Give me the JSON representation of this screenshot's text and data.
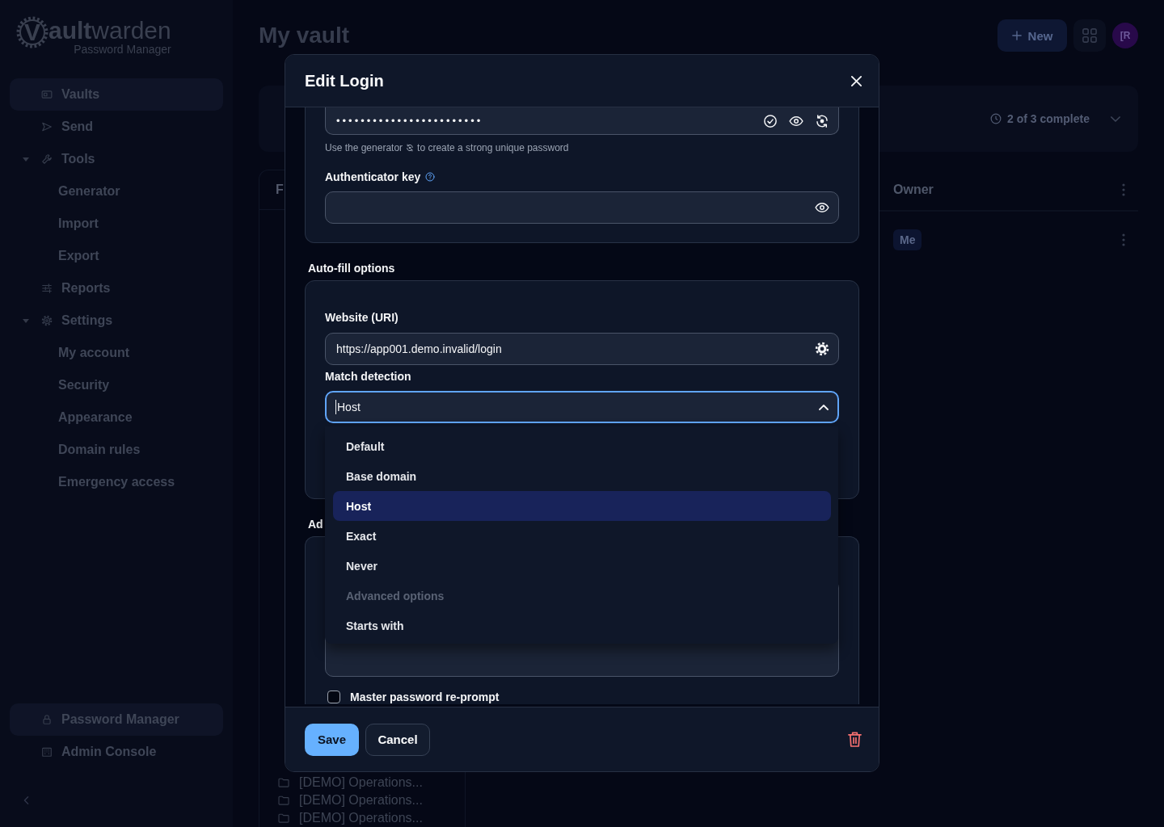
{
  "sidebar": {
    "logo": {
      "mark": "V",
      "title": "**ault**warden",
      "subtitle": "Password Manager"
    },
    "nav": [
      {
        "label": "Vaults",
        "selected": true
      },
      {
        "label": "Send",
        "selected": false
      },
      {
        "label": "Tools",
        "selected": false,
        "expanded": true,
        "children": [
          {
            "label": "Generator",
            "selected": false
          },
          {
            "label": "Import",
            "selected": false
          },
          {
            "label": "Export",
            "selected": false
          }
        ]
      },
      {
        "label": "Reports",
        "selected": false
      },
      {
        "label": "Settings",
        "selected": false,
        "expanded": true,
        "children": [
          {
            "label": "My account",
            "selected": false
          },
          {
            "label": "Security",
            "selected": false
          },
          {
            "label": "Appearance",
            "selected": false
          },
          {
            "label": "Domain rules",
            "selected": false
          },
          {
            "label": "Emergency access",
            "selected": false
          }
        ]
      }
    ],
    "products": [
      {
        "label": "Password Manager",
        "selected": true
      },
      {
        "label": "Admin Console",
        "selected": false
      }
    ]
  },
  "header": {
    "title": "My vault",
    "new_button": "New",
    "avatar": "[R"
  },
  "onboarding": {
    "progress": "2 of 3 complete"
  },
  "filters": {
    "heading": "F",
    "folders": [
      "[DEMO] Operations...",
      "[DEMO] Operations...",
      "[DEMO] Operations..."
    ]
  },
  "table": {
    "columns": [
      "Owner"
    ],
    "rows": [
      {
        "owner": "Me"
      }
    ]
  },
  "dialog": {
    "title": "Edit Login",
    "password": {
      "value": "••••••••••••••••••••••••",
      "hint_before": "Use the generator",
      "hint_after": "to create a strong unique password"
    },
    "authenticator": {
      "label": "Authenticator key"
    },
    "autofill": {
      "heading": "Auto-fill options",
      "uri_label": "Website (URI)",
      "uri": "https://app001.demo.invalid/login",
      "match_label": "Match detection",
      "match_value": "Host",
      "open": true,
      "options": [
        {
          "label": "Default",
          "kind": "option",
          "selected": false
        },
        {
          "label": "Base domain",
          "kind": "option",
          "selected": false
        },
        {
          "label": "Host",
          "kind": "option",
          "selected": true
        },
        {
          "label": "Exact",
          "kind": "option",
          "selected": false
        },
        {
          "label": "Never",
          "kind": "option",
          "selected": false
        },
        {
          "label": "Advanced options",
          "kind": "group"
        },
        {
          "label": "Starts with",
          "kind": "option",
          "selected": false
        }
      ]
    },
    "additional": {
      "heading": "Ad",
      "reprompt": {
        "label": "Master password re-prompt",
        "checked": false
      }
    },
    "buttons": {
      "save": "Save",
      "cancel": "Cancel"
    }
  }
}
